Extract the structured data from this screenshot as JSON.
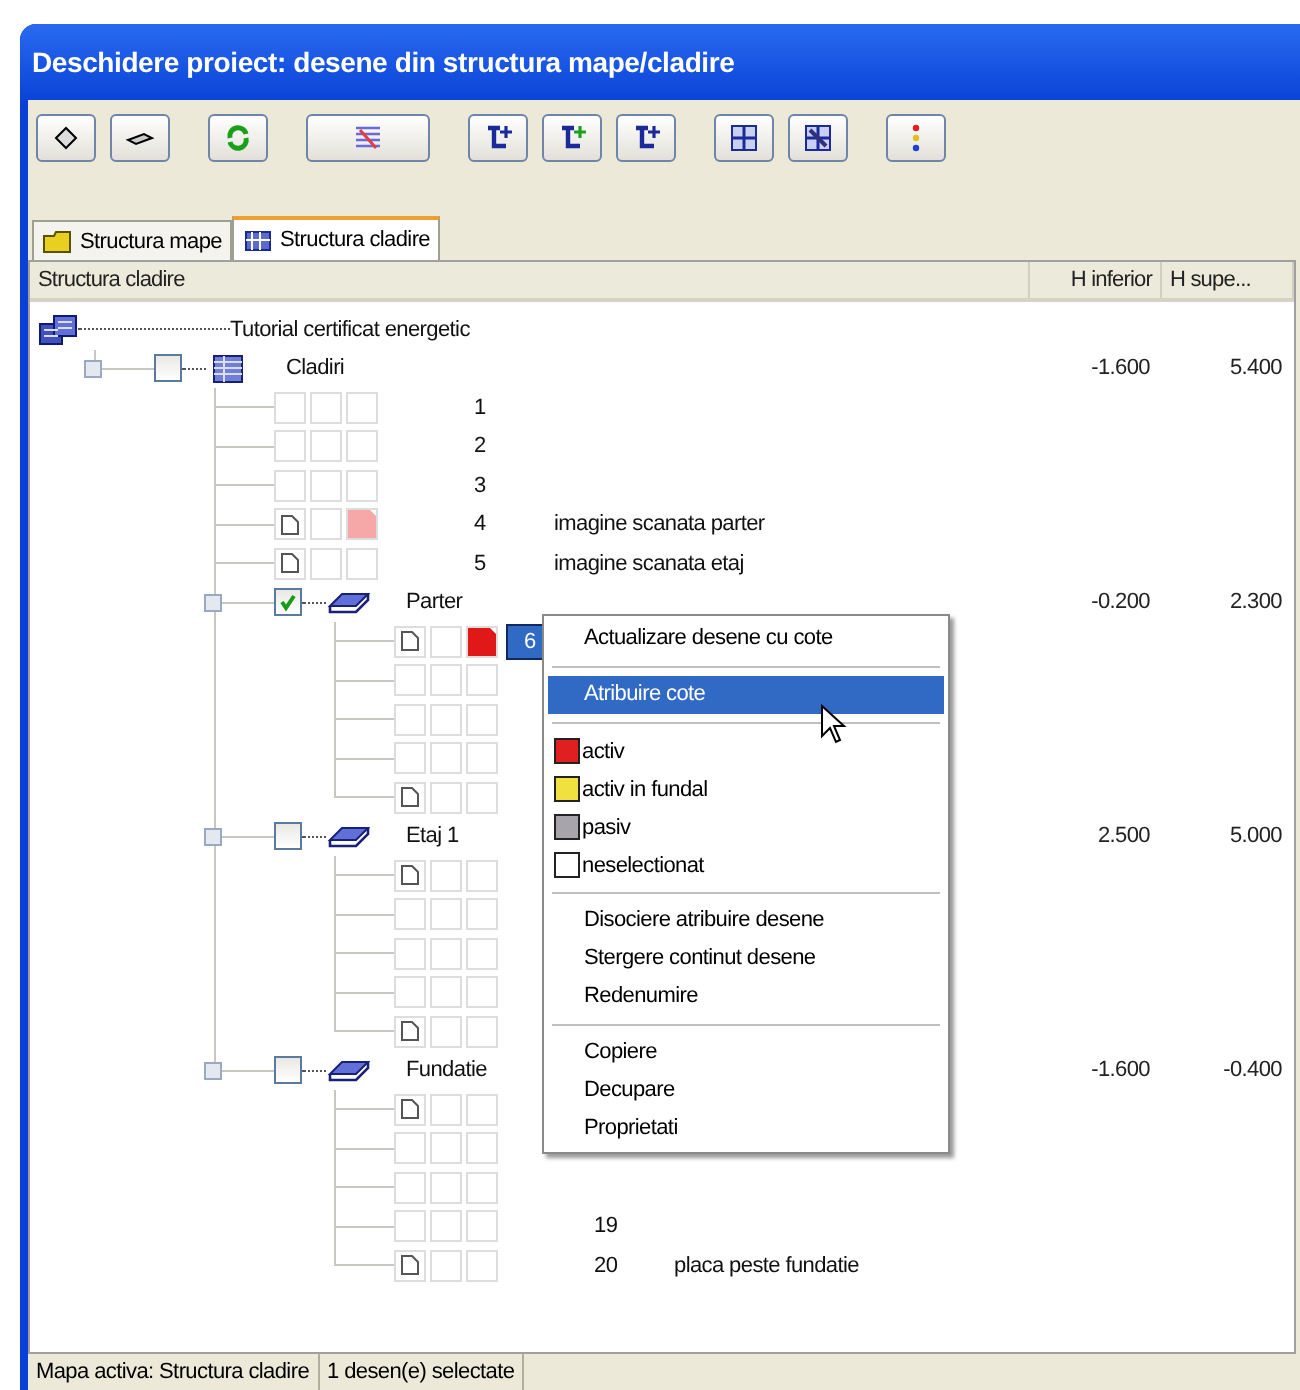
{
  "window": {
    "title": "Deschidere proiect: desene din structura mape/cladire"
  },
  "tabs": [
    {
      "label": "Structura mape",
      "selected": false
    },
    {
      "label": "Structura cladire",
      "selected": true
    }
  ],
  "columns": [
    "Structura cladire",
    "H inferior",
    "H supe..."
  ],
  "tree": {
    "label": "Tutorial certificat energetic",
    "children": [
      {
        "kind": "group",
        "label": "Cladiri",
        "checked": false,
        "h_inferior": "-1.600",
        "h_superior": "5.400",
        "children": [
          {
            "kind": "drawing",
            "number": "1",
            "file": false
          },
          {
            "kind": "drawing",
            "number": "2",
            "file": false
          },
          {
            "kind": "drawing",
            "number": "3",
            "file": false
          },
          {
            "kind": "drawing",
            "number": "4",
            "name": "imagine scanata parter",
            "file": true,
            "color": "#f6a8a8"
          },
          {
            "kind": "drawing",
            "number": "5",
            "name": "imagine scanata etaj",
            "file": true
          },
          {
            "kind": "group",
            "label": "Parter",
            "checked": true,
            "h_inferior": "-0.200",
            "h_superior": "2.300",
            "children": [
              {
                "kind": "drawing",
                "number": "6",
                "file": true,
                "color": "#e01818",
                "selected": true
              },
              {
                "kind": "drawing",
                "file": false
              },
              {
                "kind": "drawing",
                "file": false
              },
              {
                "kind": "drawing",
                "file": false
              },
              {
                "kind": "drawing",
                "file": true
              }
            ]
          },
          {
            "kind": "group",
            "label": "Etaj 1",
            "checked": false,
            "h_inferior": "2.500",
            "h_superior": "5.000",
            "children": [
              {
                "kind": "drawing",
                "file": true
              },
              {
                "kind": "drawing",
                "file": false
              },
              {
                "kind": "drawing",
                "file": false
              },
              {
                "kind": "drawing",
                "file": false
              },
              {
                "kind": "drawing",
                "file": true
              }
            ]
          },
          {
            "kind": "group",
            "label": "Fundatie",
            "checked": false,
            "h_inferior": "-1.600",
            "h_superior": "-0.400",
            "children": [
              {
                "kind": "drawing",
                "file": true
              },
              {
                "kind": "drawing",
                "file": false
              },
              {
                "kind": "drawing",
                "file": false
              },
              {
                "kind": "drawing",
                "number": "19",
                "file": false
              },
              {
                "kind": "drawing",
                "number": "20",
                "name": "placa peste fundatie",
                "file": true
              }
            ]
          }
        ]
      }
    ]
  },
  "context_menu": [
    {
      "kind": "command",
      "label": "Actualizare desene cu cote",
      "selected": false
    },
    {
      "kind": "separator"
    },
    {
      "kind": "command",
      "label": "Atribuire cote",
      "selected": true
    },
    {
      "kind": "separator"
    },
    {
      "kind": "color",
      "label": "activ",
      "color": "#e02020"
    },
    {
      "kind": "color",
      "label": "activ in fundal",
      "color": "#f0e040"
    },
    {
      "kind": "color",
      "label": "pasiv",
      "color": "#a8a4ac"
    },
    {
      "kind": "color",
      "label": "neselectionat",
      "color": "#ffffff"
    },
    {
      "kind": "separator"
    },
    {
      "kind": "command",
      "label": "Disociere atribuire desene",
      "selected": false
    },
    {
      "kind": "command",
      "label": "Stergere continut desene",
      "selected": false
    },
    {
      "kind": "command",
      "label": "Redenumire",
      "selected": false
    },
    {
      "kind": "separator"
    },
    {
      "kind": "command",
      "label": "Copiere",
      "selected": false
    },
    {
      "kind": "command",
      "label": "Decupare",
      "selected": false
    },
    {
      "kind": "command",
      "label": "Proprietati",
      "selected": false
    }
  ],
  "status_bar": [
    "Mapa activa: Structura cladire",
    "1 desen(e) selectate"
  ]
}
